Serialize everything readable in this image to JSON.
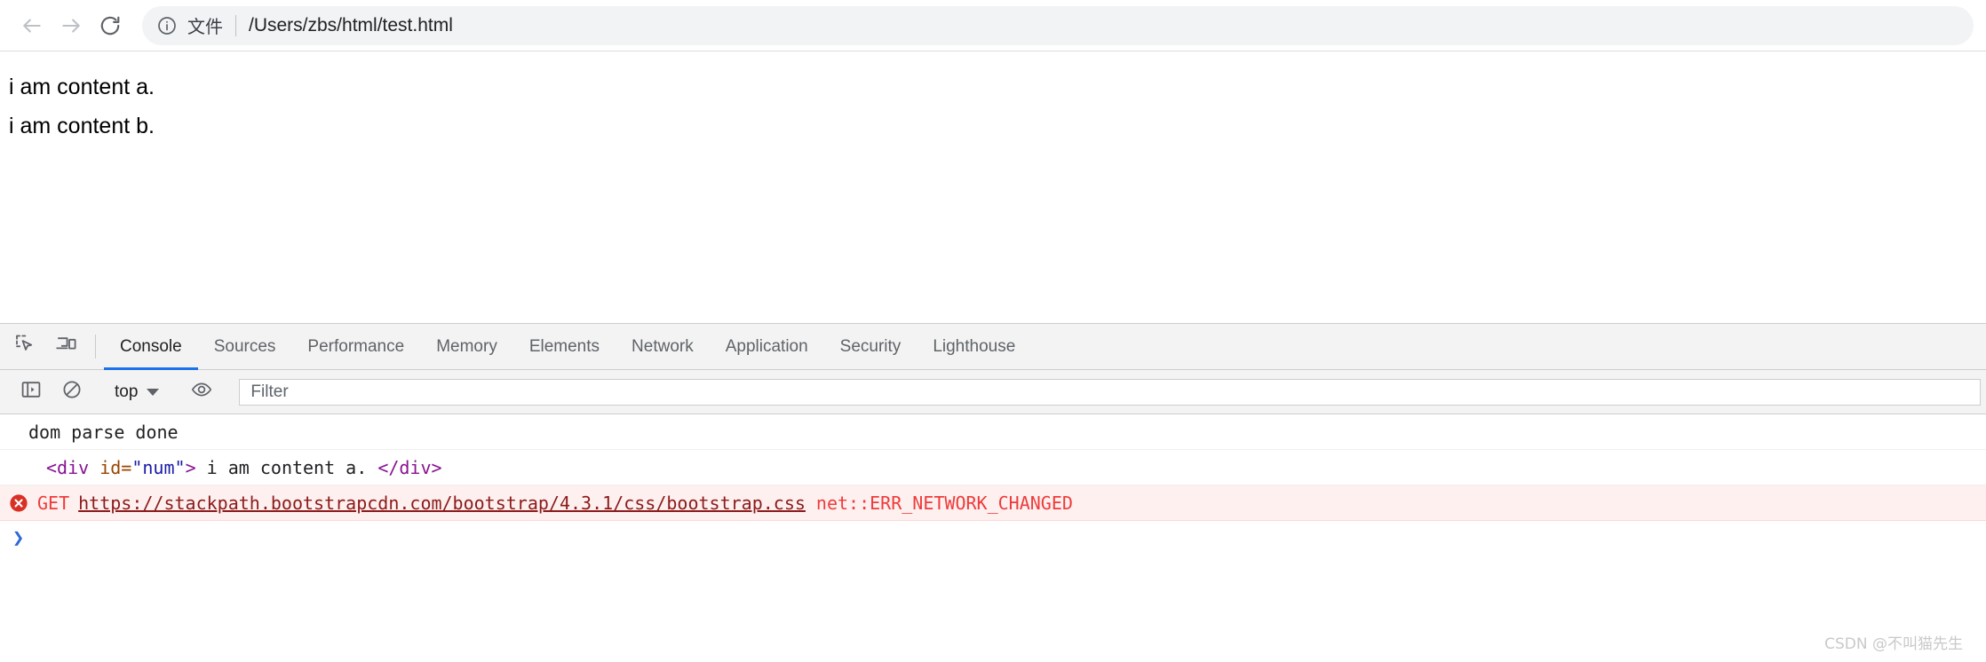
{
  "browser": {
    "back_icon": "arrow-left-icon",
    "forward_icon": "arrow-right-icon",
    "reload_icon": "reload-icon",
    "site_info_icon": "info-circle-icon",
    "scheme_label": "文件",
    "url": "/Users/zbs/html/test.html"
  },
  "page": {
    "lines": [
      "i am content a.",
      "i am content b."
    ]
  },
  "devtools": {
    "inspect_icon": "inspect-element-icon",
    "device_icon": "device-toolbar-icon",
    "tabs": [
      {
        "label": "Console",
        "active": true
      },
      {
        "label": "Sources",
        "active": false
      },
      {
        "label": "Performance",
        "active": false
      },
      {
        "label": "Memory",
        "active": false
      },
      {
        "label": "Elements",
        "active": false
      },
      {
        "label": "Network",
        "active": false
      },
      {
        "label": "Application",
        "active": false
      },
      {
        "label": "Security",
        "active": false
      },
      {
        "label": "Lighthouse",
        "active": false
      }
    ],
    "toolbar": {
      "sidebar_icon": "console-sidebar-icon",
      "clear_icon": "clear-console-icon",
      "context": "top",
      "eye_icon": "live-expression-eye-icon",
      "filter_placeholder": "Filter"
    },
    "console": {
      "log_message": "dom parse done",
      "dom_message": {
        "tag_open": "<div",
        "attr_name": " id=",
        "attr_value": "\"num\"",
        "tag_close": ">",
        "text": " i am content a. ",
        "tag_end": "</div>"
      },
      "error": {
        "icon": "error-circle-icon",
        "method": "GET",
        "url": "https://stackpath.bootstrapcdn.com/bootstrap/4.3.1/css/bootstrap.css",
        "detail": "net::ERR_NETWORK_CHANGED"
      },
      "prompt_caret": "❯"
    }
  },
  "watermark": "CSDN @不叫猫先生",
  "colors": {
    "accent": "#1a73e8",
    "error": "#ef3b3b",
    "error_bg": "#fdf0ef",
    "tag": "#881391",
    "attr": "#994500",
    "value": "#1a1aa6"
  }
}
